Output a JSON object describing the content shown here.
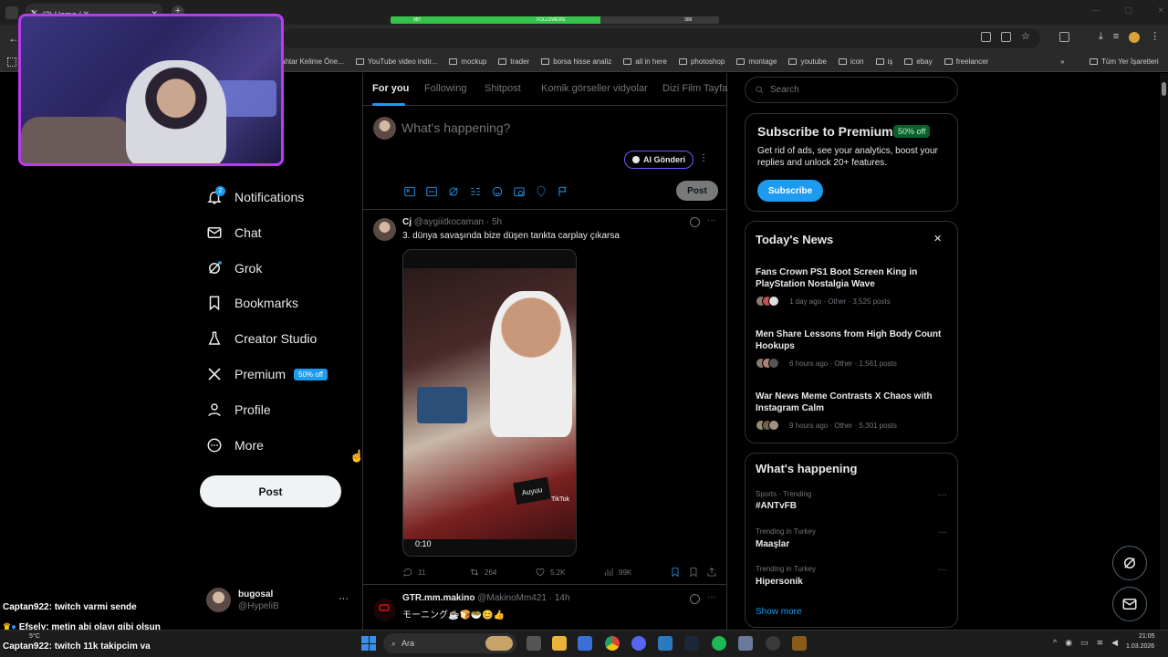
{
  "browser": {
    "tab_title": "(2) Home / X",
    "followers_label": "FOLLOWERS",
    "followers_current": "987",
    "followers_goal": "300",
    "followers_progress": 0.64,
    "bookmarks": [
      "ahtar Kelime Öne...",
      "YouTube video indir...",
      "mockup",
      "trader",
      "borsa hisse analiz",
      "all in here",
      "photoshop",
      "montage",
      "youtube",
      "icon",
      "iş",
      "ebay",
      "freelancer"
    ],
    "all_bookmarks": "Tüm Yer İşaretleri"
  },
  "nav": {
    "notifications": "Notifications",
    "notifications_count": "2",
    "chat": "Chat",
    "grok": "Grok",
    "bookmarks": "Bookmarks",
    "creator_studio": "Creator Studio",
    "premium": "Premium",
    "premium_badge": "50% off",
    "profile": "Profile",
    "more": "More",
    "post_button": "Post",
    "account_name": "bugosal",
    "account_handle": "@HypeliB"
  },
  "feed": {
    "tabs": [
      "For you",
      "Following",
      "Shitpost",
      "Komik görseller vidyolar",
      "Dizi Film Tayfa"
    ],
    "compose_placeholder": "What's happening?",
    "ai_button": "AI Gönderi",
    "post_button": "Post",
    "tweet1": {
      "name": "Cj",
      "handle": "@aygiiitkocaman",
      "time": "· 5h",
      "text": "3. dünya savaşında bize düşen tankta carplay çıkarsa",
      "video_duration": "0:10",
      "video_watermark": "TikTok",
      "video_caption": "Auyuu",
      "replies": "11",
      "reposts": "264",
      "likes": "5.2K",
      "views": "99K"
    },
    "tweet2": {
      "name": "GTR.mm.makino",
      "handle": "@MakinoMm421",
      "time": "· 14h",
      "text": "モーニング☕🍞🥗😊👍"
    }
  },
  "sidebar": {
    "search_placeholder": "Search",
    "premium_title": "Subscribe to Premium",
    "premium_badge": "50% off",
    "premium_text": "Get rid of ads, see your analytics, boost your replies and unlock 20+ features.",
    "subscribe_button": "Subscribe",
    "news_header": "Today's News",
    "news": [
      {
        "title": "Fans Crown PS1 Boot Screen King in PlayStation Nostalgia Wave",
        "meta": "1 day ago · Other · 3,525 posts"
      },
      {
        "title": "Men Share Lessons from High Body Count Hookups",
        "meta": "6 hours ago · Other · 1,561 posts"
      },
      {
        "title": "War News Meme Contrasts X Chaos with Instagram Calm",
        "meta": "9 hours ago · Other · 5,301 posts"
      }
    ],
    "happening_header": "What's happening",
    "trends": [
      {
        "category": "Sports · Trending",
        "name": "#ANTvFB"
      },
      {
        "category": "Trending in Turkey",
        "name": "Maaşlar"
      },
      {
        "category": "Trending in Turkey",
        "name": "Hipersonik"
      }
    ],
    "show_more": "Show more"
  },
  "stream_chat": [
    {
      "user": "Captan922:",
      "message": "twitch varmi sende"
    },
    {
      "user": "Efsely:",
      "message": "metin abi olayı gibi olsun"
    },
    {
      "user": "Captan922:",
      "message": "twitch 11k takipcim va"
    }
  ],
  "taskbar": {
    "search": "Ara",
    "weather": "5°C",
    "time": "21:05",
    "date": "1.03.2026"
  },
  "colors": {
    "accent": "#1d9bf0",
    "webcam_border": "#b83cf0",
    "followers_fill": "#35c24a"
  }
}
